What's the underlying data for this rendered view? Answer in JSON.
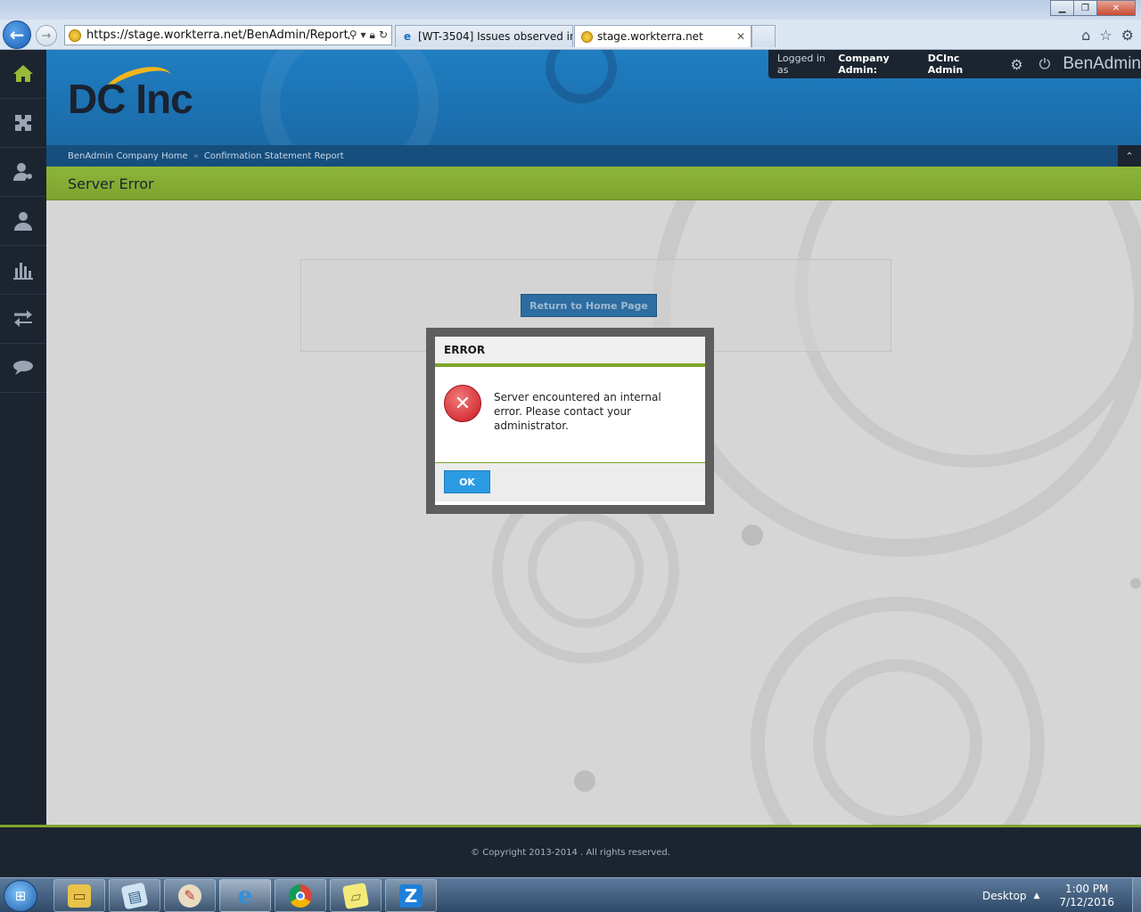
{
  "browser": {
    "address_url": "https://stage.workterra.net/BenAdmin/Report/Repc",
    "tabs": [
      {
        "label": "[WT-3504] Issues observed in B..."
      },
      {
        "label": "stage.workterra.net"
      }
    ]
  },
  "header": {
    "logo_text": "DC Inc",
    "logged_in_label": "Logged in as",
    "role_label": "Company Admin:",
    "user_name": "DCInc Admin",
    "brand": "BenAdmin"
  },
  "breadcrumb": {
    "items": [
      "BenAdmin Company Home",
      "Confirmation Statement Report"
    ],
    "separator": "»"
  },
  "page": {
    "title": "Server Error",
    "return_button": "Return to Home Page"
  },
  "modal": {
    "title": "ERROR",
    "message": "Server encountered an internal error. Please contact your administrator.",
    "ok_label": "OK"
  },
  "footer": {
    "copyright": "© Copyright 2013-2014 . All rights reserved."
  },
  "taskbar": {
    "desktop_label": "Desktop",
    "time": "1:00 PM",
    "date": "7/12/2016"
  },
  "colors": {
    "header_blue": "#1f7ec2",
    "accent_green": "#7ea42d",
    "sidebar_dark": "#1c2430",
    "error_red": "#c9181f",
    "ok_blue": "#2b9be3"
  }
}
